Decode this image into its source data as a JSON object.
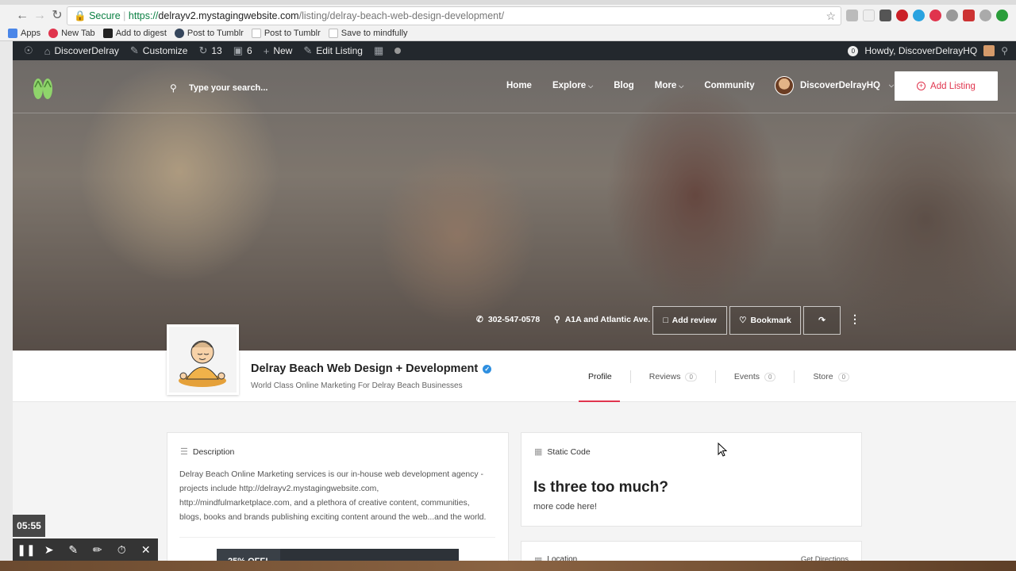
{
  "browser": {
    "url_secure": "Secure",
    "url_scheme": "https://",
    "url_host": "delrayv2.mystagingwebsite.com",
    "url_path": "/listing/delray-beach-web-design-development/",
    "bookmarks": [
      {
        "label": "Apps",
        "icon": "apps-icon",
        "color": "#4a86e8"
      },
      {
        "label": "New Tab",
        "icon": "newtab-icon",
        "color": "#e0344d"
      },
      {
        "label": "Add to digest",
        "icon": "digest-icon",
        "color": "#222"
      },
      {
        "label": "Post to Tumblr",
        "icon": "tumblr-icon",
        "color": "#35465c"
      },
      {
        "label": "Post to Tumblr",
        "icon": "page-icon",
        "color": "#bbb"
      },
      {
        "label": "Save to mindfully",
        "icon": "page-icon",
        "color": "#bbb"
      }
    ]
  },
  "wp_bar": {
    "site": "DiscoverDelray",
    "customize": "Customize",
    "updates": "13",
    "comments": "6",
    "new": "New",
    "edit": "Edit Listing",
    "notif_count": "0",
    "howdy": "Howdy, DiscoverDelrayHQ"
  },
  "site_header": {
    "search_placeholder": "Type your search...",
    "nav": {
      "home": "Home",
      "explore": "Explore",
      "blog": "Blog",
      "more": "More",
      "community": "Community"
    },
    "user": "DiscoverDelrayHQ",
    "add_listing": "Add Listing"
  },
  "hero": {
    "phone": "302-547-0578",
    "address": "A1A and Atlantic Ave.",
    "add_review": "Add review",
    "bookmark": "Bookmark"
  },
  "listing": {
    "title": "Delray Beach Web Design + Development",
    "tagline": "World Class Online Marketing For Delray Beach Businesses",
    "tabs": [
      {
        "label": "Profile",
        "count": ""
      },
      {
        "label": "Reviews",
        "count": "0"
      },
      {
        "label": "Events",
        "count": "0"
      },
      {
        "label": "Store",
        "count": "0"
      }
    ]
  },
  "description": {
    "heading": "Description",
    "lines": [
      "Delray Beach Online Marketing services is our in-house web development agency -",
      "projects include http://delrayv2.mystagingwebsite.com,",
      "http://mindfulmarketplace.com, and a plethora of creative content, communities,",
      "blogs, books and brands publishing exciting content around the web...and the world."
    ],
    "coupon": "25% OFF!"
  },
  "static_code": {
    "heading": "Static Code",
    "title": "Is three too much?",
    "body": "more code here!"
  },
  "location": {
    "heading": "Location",
    "link": "Get Directions"
  },
  "recorder": {
    "time": "05:55"
  }
}
